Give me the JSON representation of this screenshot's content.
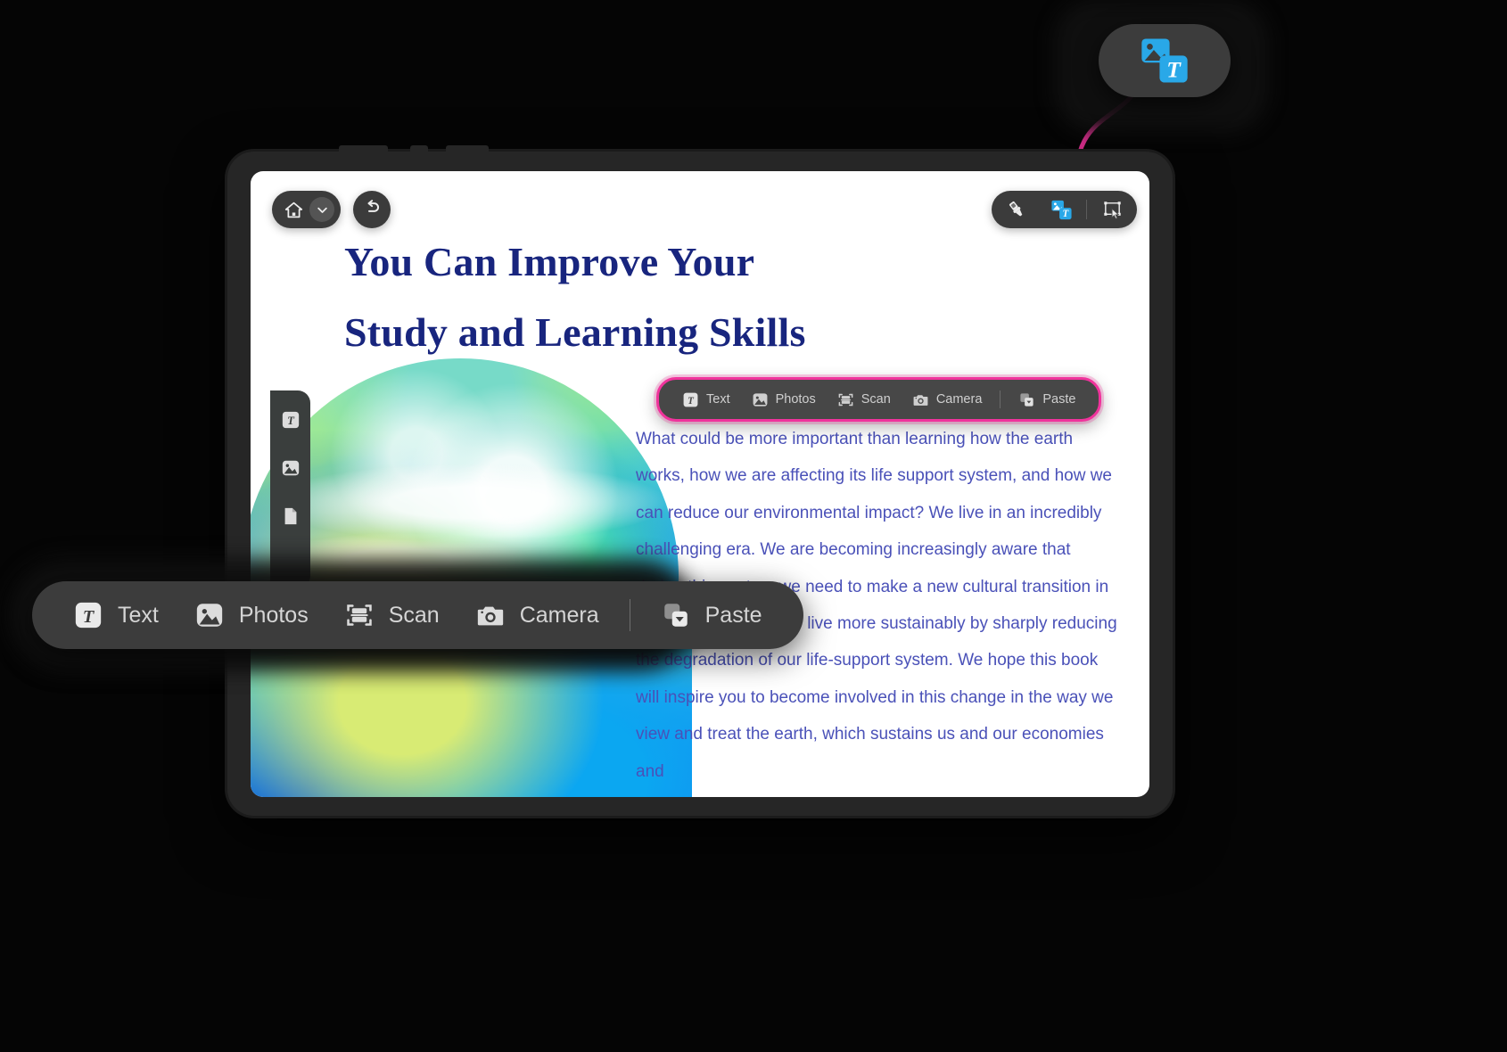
{
  "app": {
    "type": "tablet-note-editor",
    "accent_annotation_color": "#f0339c",
    "toolbar_bg": "#3c3c3c",
    "heading_color": "#18257e",
    "body_color": "#4a51b8"
  },
  "topleft": {
    "home_label": "home-icon",
    "chevron_label": "chevron-down-icon",
    "undo_label": "undo-icon"
  },
  "toptools": {
    "items": [
      {
        "icon": "marker-pen-icon",
        "name": "marker-tool"
      },
      {
        "icon": "insert-image-text-icon",
        "name": "insert-object-tool",
        "active": true
      },
      {
        "icon": "select-lasso-icon",
        "name": "select-tool"
      }
    ]
  },
  "rail": {
    "items": [
      {
        "icon": "text-icon",
        "name": "rail-text"
      },
      {
        "icon": "image-icon",
        "name": "rail-photos"
      },
      {
        "icon": "document-icon",
        "name": "rail-document"
      }
    ]
  },
  "document": {
    "title_line1": "You Can Improve Your",
    "title_line2": "Study and Learning Skills",
    "body": "What could be more important than learning how the earth works, how we are affecting its life support system, and how we can reduce our environmental impact? We live in an incredibly challenging era. We are becoming increasingly aware that during this century we need to make a new cultural transition in which we learn how to live more sustainably by sharply reducing the degradation of our life-support system. We hope this book will inspire you to become involved in this change in the way we view and treat the earth, which sustains us and our economies and"
  },
  "insert_toolbar": {
    "items": [
      {
        "label": "Text",
        "icon": "text-icon"
      },
      {
        "label": "Photos",
        "icon": "image-icon"
      },
      {
        "label": "Scan",
        "icon": "scan-icon"
      },
      {
        "label": "Camera",
        "icon": "camera-icon"
      },
      {
        "label": "Paste",
        "icon": "paste-icon"
      }
    ]
  },
  "callout_toolbar": {
    "items": [
      {
        "label": "Text",
        "icon": "text-icon"
      },
      {
        "label": "Photos",
        "icon": "image-icon"
      },
      {
        "label": "Scan",
        "icon": "scan-icon"
      },
      {
        "label": "Camera",
        "icon": "camera-icon"
      },
      {
        "label": "Paste",
        "icon": "paste-icon"
      }
    ]
  },
  "icon_callout": {
    "icon": "insert-image-text-icon",
    "color": "#29a8e8"
  }
}
